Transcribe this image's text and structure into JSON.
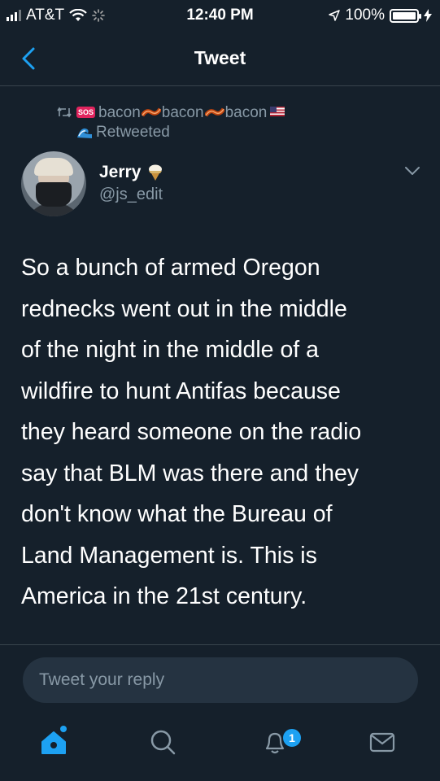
{
  "status_bar": {
    "carrier": "AT&T",
    "time": "12:40 PM",
    "battery": "100%"
  },
  "nav": {
    "title": "Tweet"
  },
  "retweet": {
    "retweeter_name_parts": [
      "bacon",
      "bacon",
      "bacon"
    ],
    "label": "Retweeted"
  },
  "author": {
    "name": "Jerry",
    "handle": "@js_edit"
  },
  "tweet": {
    "lines": [
      "So a bunch of armed Oregon",
      "rednecks went out in the middle",
      "of the night in the middle of a",
      "wildfire to hunt Antifas because",
      "they heard someone on the radio",
      "say that BLM was there and they",
      "don't know what the Bureau of",
      "Land Management is. This is",
      "America in the 21st century."
    ]
  },
  "reply": {
    "placeholder": "Tweet your reply"
  },
  "tab_bar": {
    "notification_count": "1"
  },
  "colors": {
    "background": "#15202b",
    "accent": "#1da1f2",
    "secondary_text": "#8899a6",
    "divider": "#38444d"
  },
  "icons": [
    "back-chevron-icon",
    "retweet-icon",
    "sos-icon",
    "bacon-icon",
    "us-flag-icon",
    "wave-icon",
    "ice-cream-icon",
    "chevron-down-icon",
    "home-icon",
    "search-icon",
    "notifications-icon",
    "messages-icon"
  ]
}
